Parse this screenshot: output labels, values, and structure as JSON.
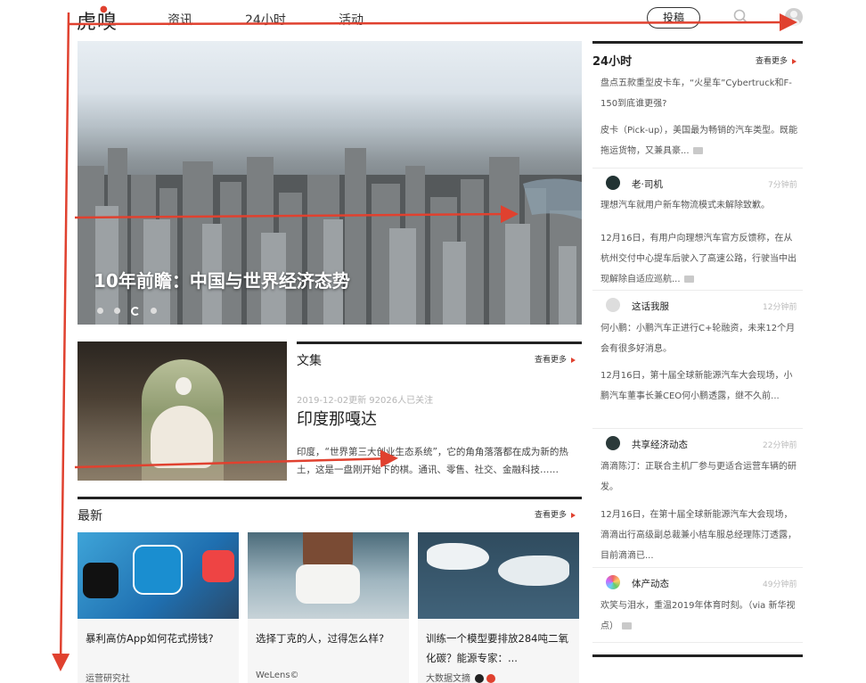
{
  "header": {
    "logo": "虎嗅",
    "nav": [
      "资讯",
      "24小时",
      "活动"
    ],
    "submit_label": "投稿"
  },
  "hero": {
    "title": "10年前瞻：中国与世界经济态势"
  },
  "collection": {
    "section_title": "文集",
    "more_label": "查看更多",
    "meta": "2019-12-02更新   92026人已关注",
    "headline": "印度那嘎达",
    "description": "印度，“世界第三大创业生态系统”，它的角角落落都在成为新的热土，这是一盘刚开始下的棋。通讯、零售、社交、金融科技……"
  },
  "latest": {
    "section_title": "最新",
    "more_label": "查看更多",
    "cards": [
      {
        "title": "暴利高仿App如何花式捞钱?",
        "source": "运营研究社"
      },
      {
        "title": "选择丁克的人，过得怎么样?",
        "source": "WeLens©"
      },
      {
        "title": "训练一个模型要排放284吨二氧化碳？能源专家：...",
        "source": "大数据文摘"
      }
    ]
  },
  "sidebar": {
    "title": "24小时",
    "more_label": "查看更多",
    "top_headline": "盘点五款重型皮卡车，“火星车”Cybertruck和F-150到底谁更强?",
    "top_summary": "皮卡（Pick-up），美国最为畅销的汽车类型。既能拖运货物，又兼具豪...",
    "items": [
      {
        "author": "老·司机",
        "time": "7分钟前",
        "headline": "理想汽车就用户新车物流模式未解除致歉。",
        "summary": "12月16日，有用户向理想汽车官方反馈称，在从杭州交付中心提车后驶入了高速公路，行驶当中出现解除自适应巡航..."
      },
      {
        "author": "这话我服",
        "time": "12分钟前",
        "headline": "何小鹏：小鹏汽车正进行C+轮融资，未来12个月会有很多好消息。",
        "summary": "12月16日，第十届全球新能源汽车大会现场，小鹏汽车董事长兼CEO何小鹏透露，继不久前..."
      },
      {
        "author": "共享经济动态",
        "time": "22分钟前",
        "headline": "滴滴陈汀：正联合主机厂参与更适合运营车辆的研发。",
        "summary": "12月16日，在第十届全球新能源汽车大会现场，滴滴出行高级副总裁兼小桔车服总经理陈汀透露，目前滴滴已..."
      },
      {
        "author": "体产动态",
        "time": "49分钟前",
        "headline": "欢笑与泪水，重温2019年体育时刻。（via 新华视点）"
      }
    ]
  },
  "colors": {
    "accent": "#e0412f",
    "rule": "#222222",
    "muted": "#b5b5b5"
  }
}
